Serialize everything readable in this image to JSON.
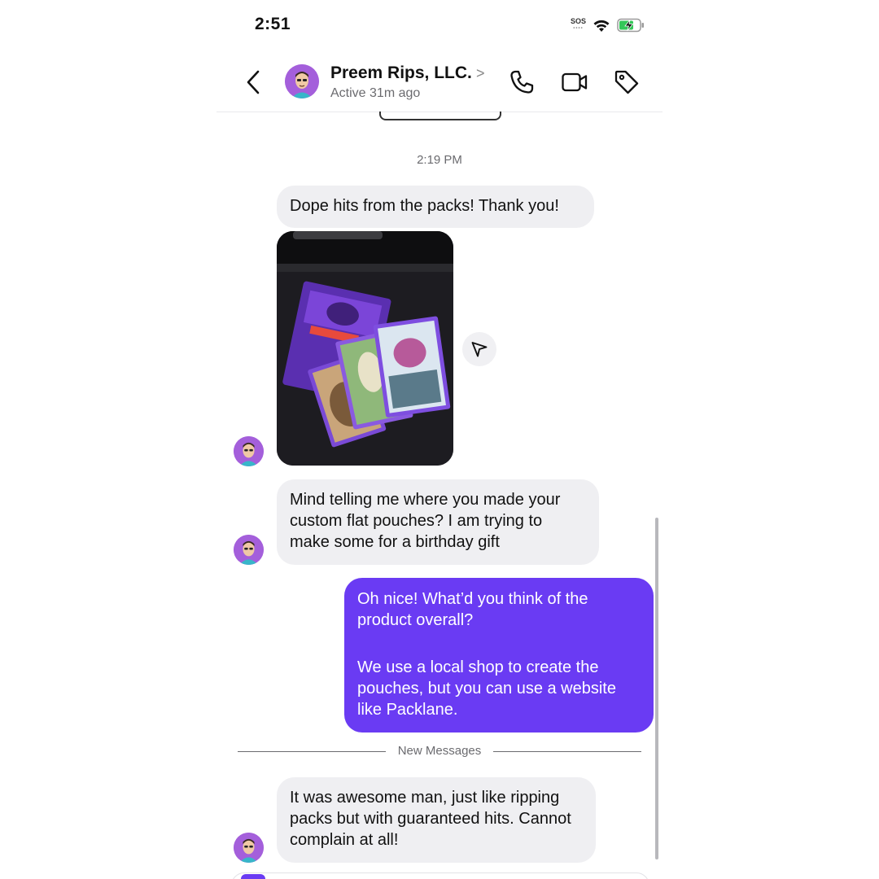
{
  "status_bar": {
    "time": "2:51",
    "sos": "SOS"
  },
  "header": {
    "back_icon": "chevron-left-icon",
    "title": "Preem Rips, LLC.",
    "title_chevron": ">",
    "subtitle": "Active 31m ago",
    "icons": [
      "phone-icon",
      "video-camera-icon",
      "tag-icon"
    ]
  },
  "thread": {
    "timestamp": "2:19 PM",
    "messages": [
      {
        "sender": "them",
        "text": "Dope hits from the packs! Thank you!"
      },
      {
        "sender": "them",
        "type": "image"
      },
      {
        "sender": "them",
        "text": "Mind telling me where you made your custom flat pouches? I am trying to make some for a birthday gift"
      },
      {
        "sender": "me",
        "paragraphs": [
          "Oh nice! What’d you think of the product overall?",
          "We use a local shop to create the pouches, but you can use a website like Packlane."
        ]
      },
      {
        "sender": "them",
        "text": "It was awesome man, just like ripping packs but with guaranteed hits. Cannot complain at all!"
      }
    ],
    "new_messages_label": "New Messages"
  },
  "colors": {
    "accent": "#6a3bf3",
    "incoming_bubble": "#efeff2",
    "avatar_bg": "#a45fdb",
    "battery": "#34c759"
  }
}
